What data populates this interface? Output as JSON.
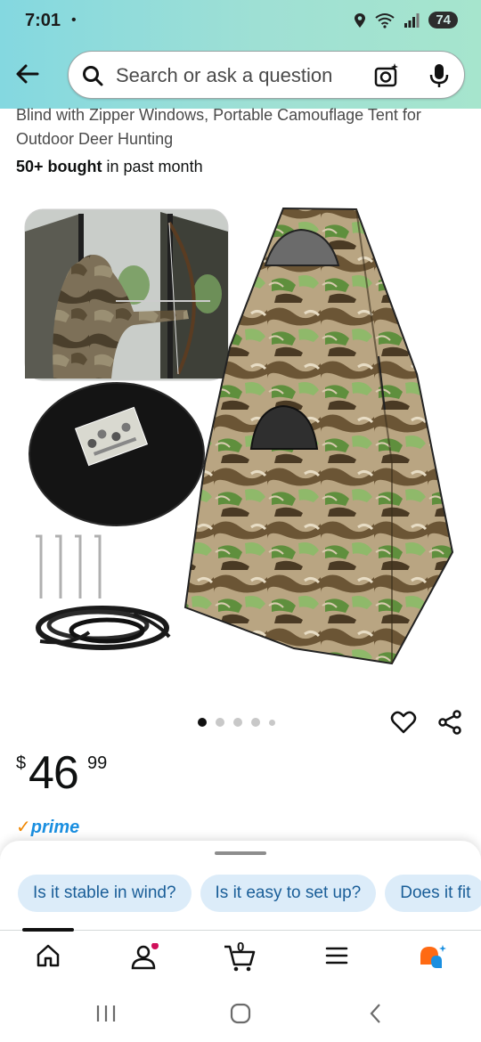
{
  "status": {
    "time": "7:01",
    "dot": "•",
    "battery": "74"
  },
  "search": {
    "placeholder": "Search or ask a question"
  },
  "product": {
    "title_fragment": "Blind with Zipper Windows, Portable Camouflage Tent for Outdoor Deer Hunting",
    "bought_bold": "50+ bought",
    "bought_rest": " in past month",
    "price_currency": "$",
    "price_whole": "46",
    "price_fraction": "99",
    "prime_label": "prime",
    "image_count": 5,
    "active_image_index": 0
  },
  "suggestions": [
    "Is it stable in wind?",
    "Is it easy to set up?",
    "Does it fit"
  ],
  "nav": {
    "cart_count": "0",
    "items": [
      "home-icon",
      "account-icon",
      "cart-icon",
      "menu-icon",
      "rufus-icon"
    ]
  },
  "colors": {
    "accent_blue": "#1a8fe0",
    "prime_check": "#f08804",
    "chip_bg": "#dcecf9",
    "header_start": "#84d8e0",
    "header_end": "#a6e5cd"
  }
}
